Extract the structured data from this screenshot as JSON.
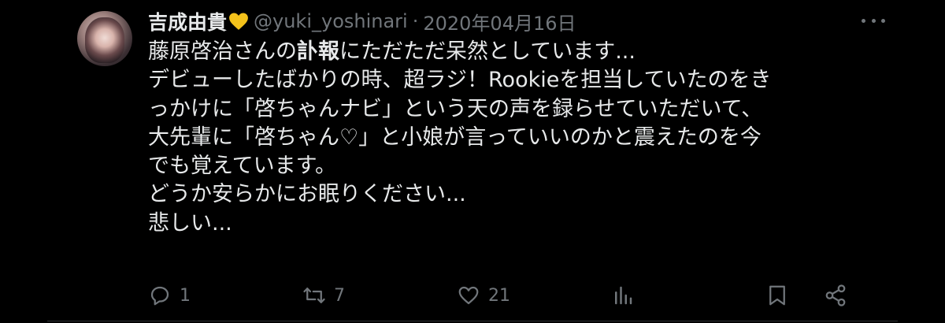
{
  "tweet": {
    "author": {
      "display_name": "吉成由貴",
      "emoji_icon": "yellow-heart-icon",
      "handle": "@yuki_yoshinari",
      "separator": "·",
      "date": "2020年04月16日"
    },
    "body_lines": [
      {
        "before": "藤原啓治さんの",
        "bold": "訃報",
        "after": "にただただ呆然としています..."
      },
      {
        "before": "デビューしたばかりの時、超ラジ！Rookieを担当していたのをき",
        "bold": "",
        "after": ""
      },
      {
        "before": "っかけに「啓ちゃんナビ」という天の声を録らせていただいて、",
        "bold": "",
        "after": ""
      },
      {
        "before": "大先輩に「啓ちゃん♡」と小娘が言っていいのかと震えたのを今",
        "bold": "",
        "after": ""
      },
      {
        "before": "でも覚えています。",
        "bold": "",
        "after": ""
      },
      {
        "before": "どうか安らかにお眠りください...",
        "bold": "",
        "after": ""
      },
      {
        "before": "悲しい...",
        "bold": "",
        "after": ""
      }
    ],
    "actions": {
      "reply_count": "1",
      "retweet_count": "7",
      "like_count": "21"
    }
  },
  "colors": {
    "background": "#000000",
    "text": "#e7e9ea",
    "muted": "#71767b",
    "heart": "#f4c21b"
  }
}
